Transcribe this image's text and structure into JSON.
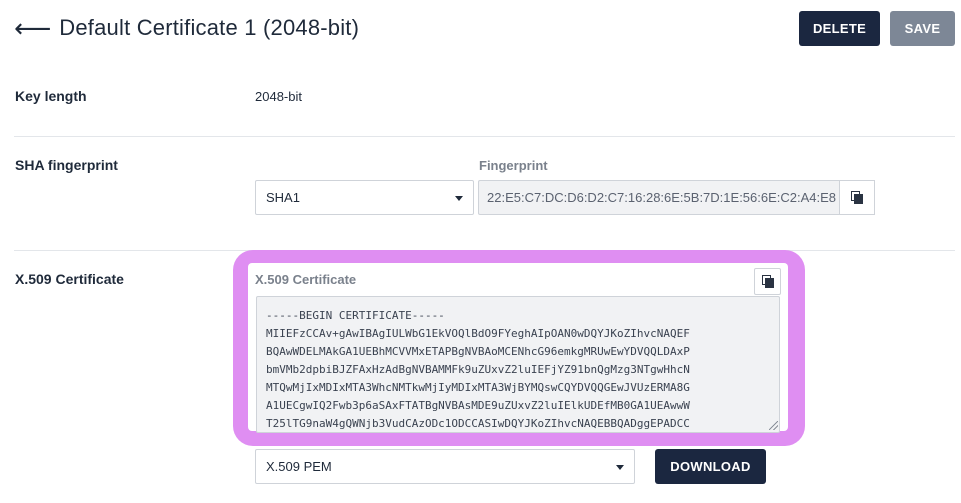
{
  "header": {
    "back_icon": "arrow-left-icon",
    "title": "Default Certificate 1 (2048-bit)"
  },
  "toolbar": {
    "delete_label": "DELETE",
    "save_label": "SAVE",
    "delete_color": "#1b2740",
    "save_color": "#7d8796"
  },
  "key_length": {
    "label": "Key length",
    "value": "2048-bit"
  },
  "sha": {
    "label": "SHA fingerprint",
    "algorithm": "SHA1",
    "fingerprint_label": "Fingerprint",
    "fingerprint_value": "22:E5:C7:DC:D6:D2:C7:16:28:6E:5B:7D:1E:56:6E:C2:A4:E8",
    "copy_icon": "copy-icon"
  },
  "certificate": {
    "label": "X.509 Certificate",
    "field_label": "X.509 Certificate",
    "copy_icon": "copy-icon",
    "highlight_color": "#df8ef2",
    "content": "-----BEGIN CERTIFICATE-----\nMIIEFzCCAv+gAwIBAgIULWbG1EkVOQlBdO9FYeghAIpOAN0wDQYJKoZIhvcNAQEF\nBQAwWDELMAkGA1UEBhMCVVMxETAPBgNVBAoMCENhcG96emkgMRUwEwYDVQQLDAxP\nbmVMb2dpbiBJZFAxHzAdBgNVBAMMFk9uZUxvZ2luIEFjYZ91bnQgMzg3NTgwHhcN\nMTQwMjIxMDIxMTA3WhcNMTkwMjIyMDIxMTA3WjBYMQswCQYDVQQGEwJVUzERMA8G\nA1UECgwIQ2Fwb3p6aSAxFTATBgNVBAsMDE9uZUxvZ2luIElkUDEfMB0GA1UEAwwW\nT25lTG9naW4gQWNjb3VudCAzODc1ODCCASIwDQYJKoZIhvcNAQEBBQADggEPADCC",
    "format": "X.509 PEM",
    "download_label": "DOWNLOAD"
  }
}
